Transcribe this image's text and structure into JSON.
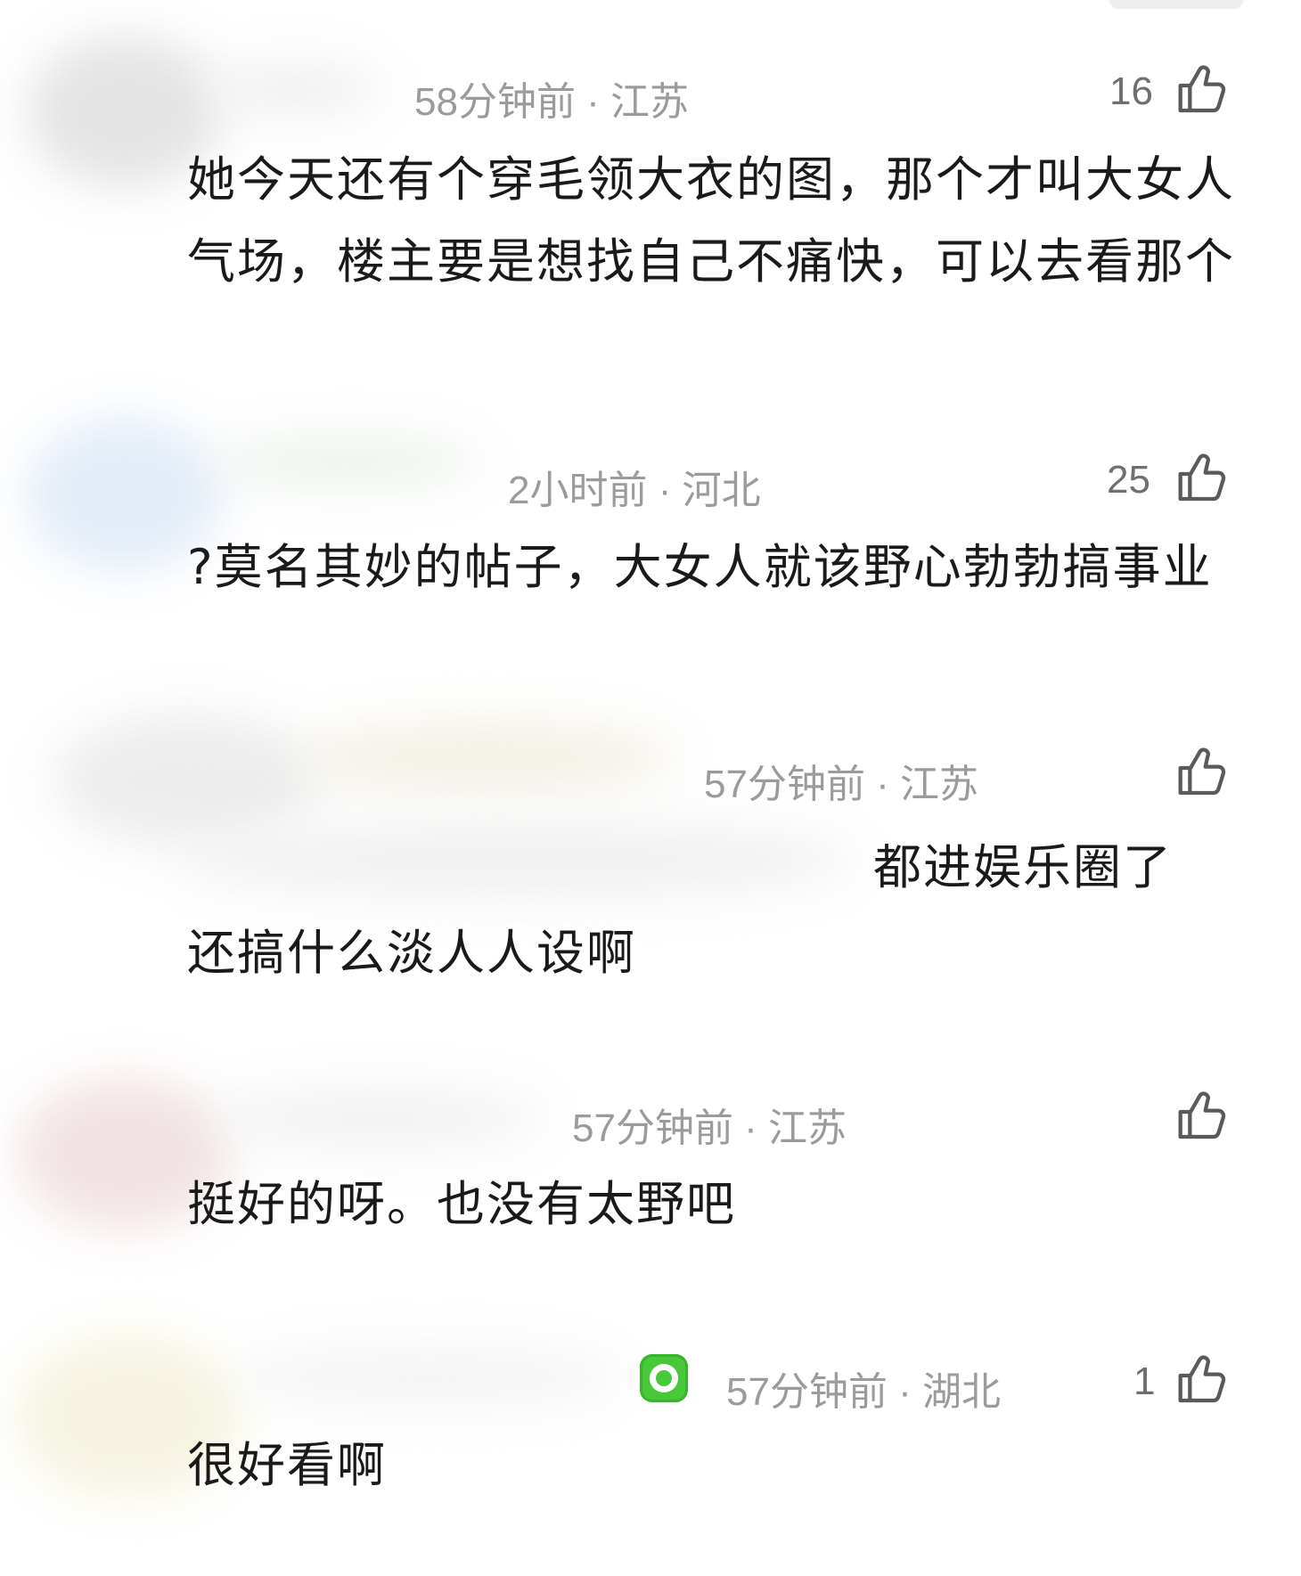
{
  "comments": [
    {
      "meta": "58分钟前 · 江苏",
      "likes": "16",
      "text": "她今天还有个穿毛领大衣的图，那个才叫大女人气场，楼主要是想找自己不痛快，可以去看那个"
    },
    {
      "meta": "2小时前 · 河北",
      "likes": "25",
      "text": "?莫名其妙的帖子，大女人就该野心勃勃搞事业"
    },
    {
      "meta": "57分钟前 · 江苏",
      "likes": "",
      "text_part1": "都进娱乐圈了",
      "text_part2": "还搞什么淡人人设啊"
    },
    {
      "meta": "57分钟前 · 江苏",
      "likes": "",
      "text": "挺好的呀。也没有太野吧"
    },
    {
      "meta": "57分钟前 · 湖北",
      "likes": "1",
      "text": "很好看啊"
    }
  ],
  "colors": {
    "meta_text": "#9b9b9b",
    "body_text": "#1a1a1a",
    "icon_stroke": "#5a5a5a",
    "app_badge": "#47c93a"
  },
  "icons": [
    "thumbs-up-icon",
    "app-badge-icon"
  ]
}
